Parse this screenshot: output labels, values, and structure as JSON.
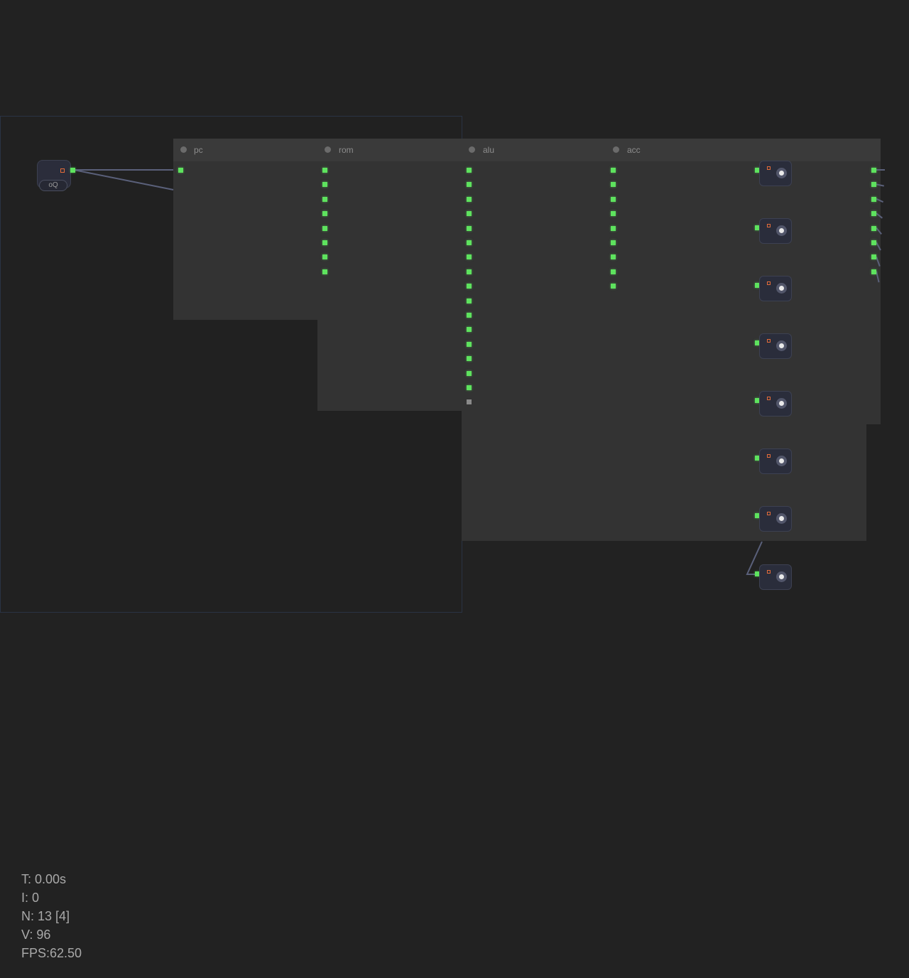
{
  "modules": [
    {
      "id": "pc",
      "title": "pc"
    },
    {
      "id": "rom",
      "title": "rom"
    },
    {
      "id": "alu",
      "title": "alu"
    },
    {
      "id": "acc",
      "title": "acc"
    }
  ],
  "clock": {
    "label": "oQ"
  },
  "stats": {
    "time": "T: 0.00s",
    "iterations": "I: 0",
    "nodes": "N: 13 [4]",
    "vertices": "V: 96",
    "fps": "FPS:62.50"
  },
  "colors": {
    "background": "#222222",
    "module_body": "#333333",
    "port_active": "#5ee35e",
    "port_inactive": "#8a8a8a",
    "wire": "#5a607a",
    "display_accent": "#e46c3a"
  },
  "ports": {
    "pc_outputs": 1,
    "rom_outputs": 8,
    "alu_outputs": 16,
    "alu_inactive_outputs": 1,
    "acc_outputs": 9,
    "display_inputs": 8,
    "bus_outputs": 8
  },
  "icons": {
    "display": "bit-display-icon",
    "clock": "clock-node-icon"
  }
}
